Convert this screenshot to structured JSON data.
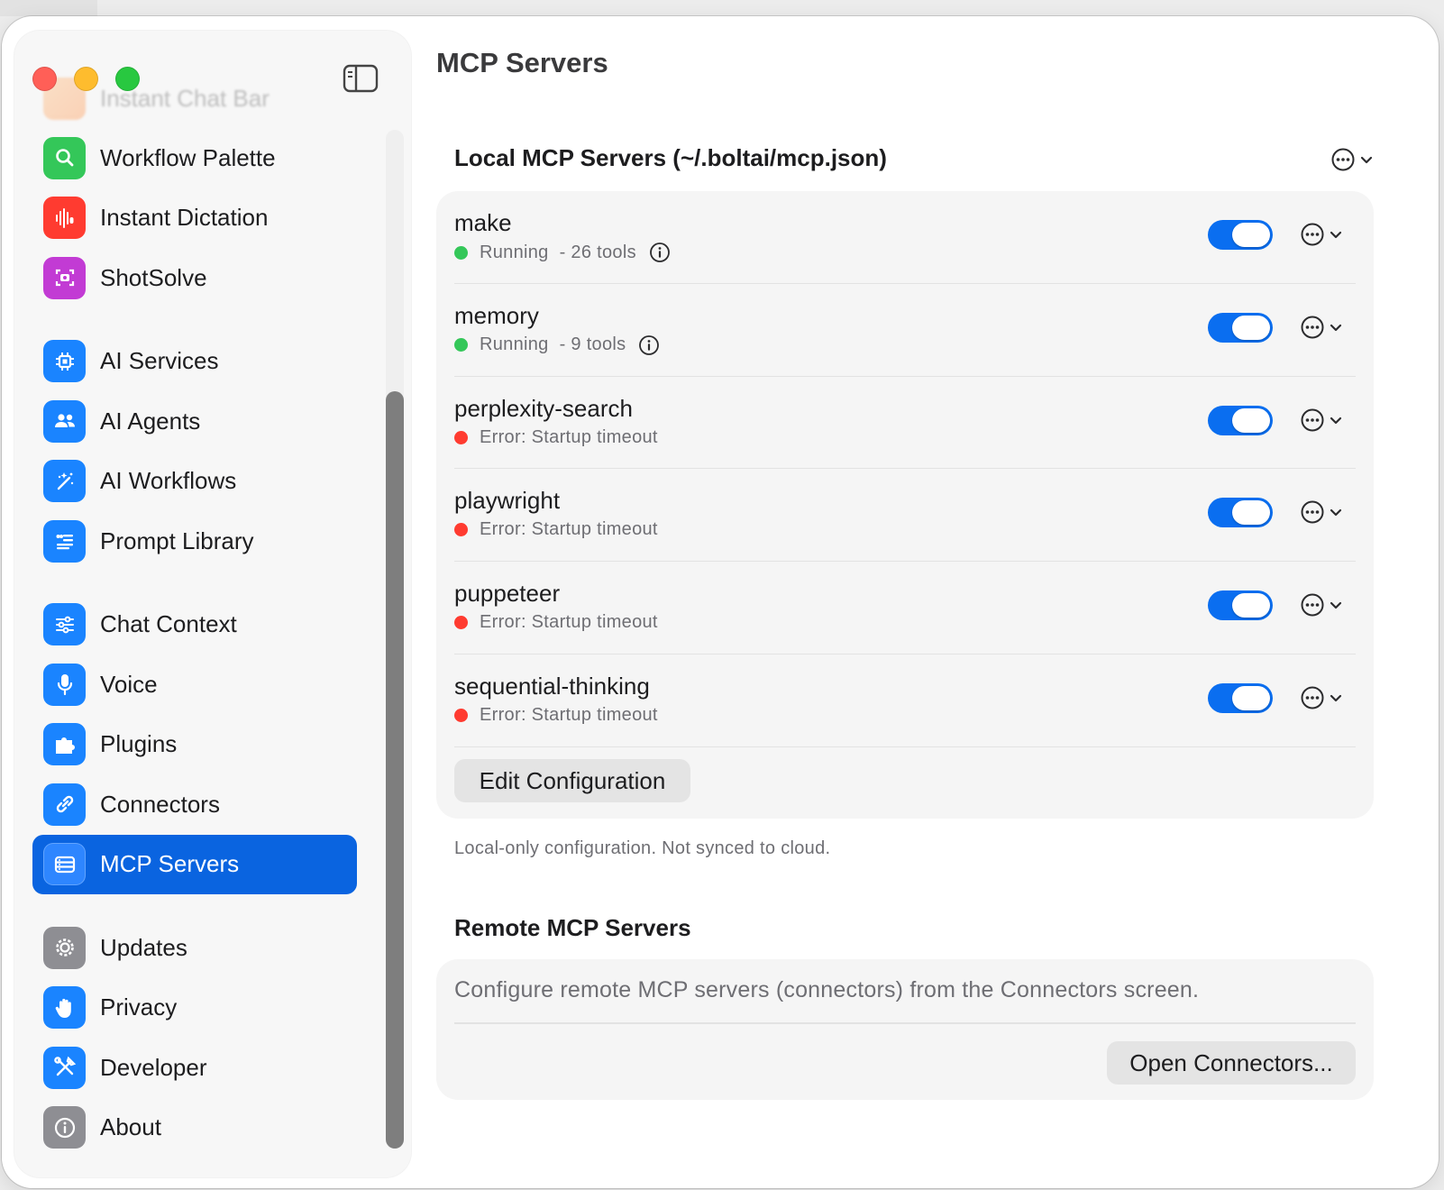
{
  "window": {
    "page_title": "MCP Servers"
  },
  "sidebar": {
    "faded_item": "Instant Chat Bar",
    "groups": [
      [
        {
          "label": "Workflow Palette",
          "icon": "search-icon",
          "color": "#34c759"
        },
        {
          "label": "Instant Dictation",
          "icon": "waveform-icon",
          "color": "#ff3b30"
        },
        {
          "label": "ShotSolve",
          "icon": "screenshot-icon",
          "color": "#c23bd4"
        }
      ],
      [
        {
          "label": "AI Services",
          "icon": "chip-icon",
          "color": "#1a84ff"
        },
        {
          "label": "AI Agents",
          "icon": "people-icon",
          "color": "#1a84ff"
        },
        {
          "label": "AI Workflows",
          "icon": "magic-wand-icon",
          "color": "#1a84ff"
        },
        {
          "label": "Prompt Library",
          "icon": "quote-list-icon",
          "color": "#1a84ff"
        }
      ],
      [
        {
          "label": "Chat Context",
          "icon": "sliders-icon",
          "color": "#1a84ff"
        },
        {
          "label": "Voice",
          "icon": "microphone-icon",
          "color": "#1a84ff"
        },
        {
          "label": "Plugins",
          "icon": "puzzle-icon",
          "color": "#1a84ff"
        },
        {
          "label": "Connectors",
          "icon": "link-icon",
          "color": "#1a84ff"
        },
        {
          "label": "MCP Servers",
          "icon": "server-icon",
          "color": "#1a84ff",
          "active": true
        }
      ],
      [
        {
          "label": "Updates",
          "icon": "gear-icon",
          "color": "#8e8e93"
        },
        {
          "label": "Privacy",
          "icon": "hand-icon",
          "color": "#1a84ff"
        },
        {
          "label": "Developer",
          "icon": "tools-icon",
          "color": "#1a84ff"
        },
        {
          "label": "About",
          "icon": "info-icon",
          "color": "#8e8e93"
        }
      ]
    ]
  },
  "local": {
    "title": "Local MCP Servers (~/.boltai/mcp.json)",
    "servers": [
      {
        "name": "make",
        "status": "Running",
        "tools": "- 26 tools",
        "ok": true,
        "enabled": true
      },
      {
        "name": "memory",
        "status": "Running",
        "tools": "- 9 tools",
        "ok": true,
        "enabled": true
      },
      {
        "name": "perplexity-search",
        "status": "Error: Startup timeout",
        "ok": false,
        "enabled": true
      },
      {
        "name": "playwright",
        "status": "Error: Startup timeout",
        "ok": false,
        "enabled": true
      },
      {
        "name": "puppeteer",
        "status": "Error: Startup timeout",
        "ok": false,
        "enabled": true
      },
      {
        "name": "sequential-thinking",
        "status": "Error: Startup timeout",
        "ok": false,
        "enabled": true
      }
    ],
    "edit_button": "Edit Configuration",
    "note": "Local-only configuration. Not synced to cloud."
  },
  "remote": {
    "title": "Remote MCP Servers",
    "description": "Configure remote MCP servers (connectors) from the Connectors screen.",
    "button": "Open Connectors..."
  },
  "colors": {
    "accent": "#0a64e0",
    "running": "#34c759",
    "error": "#ff3b30"
  }
}
